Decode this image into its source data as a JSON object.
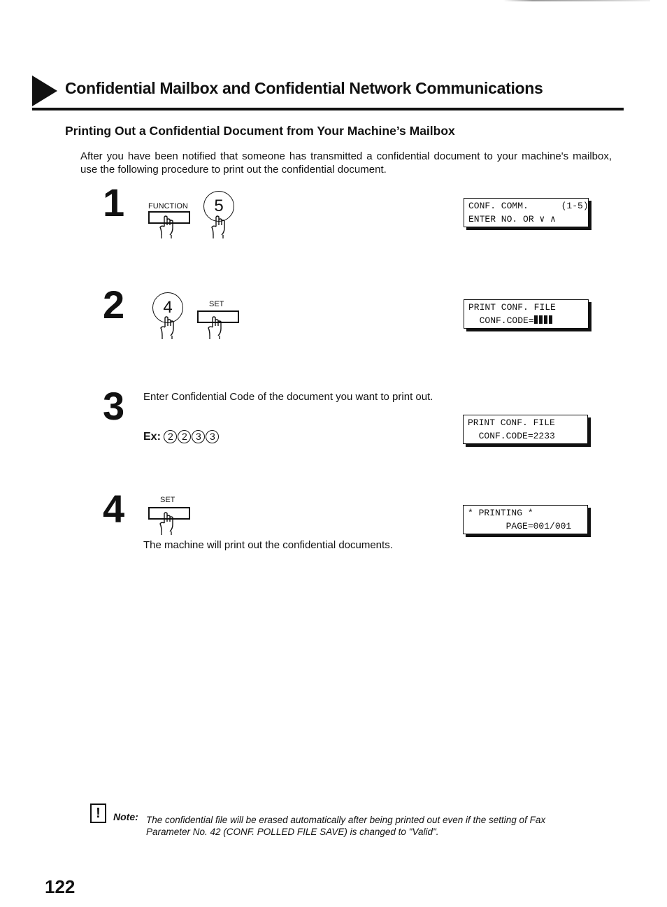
{
  "header": {
    "title": "Confidential Mailbox and Confidential Network Communications"
  },
  "section": {
    "title": "Printing Out a Confidential Document from Your Machine’s Mailbox",
    "intro": "After you have been notified that someone has transmitted a confidential document to your machine's mailbox, use the following procedure to print out the confidential document."
  },
  "steps": [
    {
      "number": "1",
      "keys": [
        {
          "type": "rect",
          "label": "FUNCTION"
        },
        {
          "type": "circle",
          "label": "5"
        }
      ],
      "lcd": [
        "CONF. COMM.      (1-5)",
        "ENTER NO. OR ∨ ∧"
      ]
    },
    {
      "number": "2",
      "keys": [
        {
          "type": "circle",
          "label": "4"
        },
        {
          "type": "rect",
          "label": "SET"
        }
      ],
      "lcd": [
        "PRINT CONF. FILE",
        "  CONF.CODE="
      ],
      "lcd_mask_count": 4
    },
    {
      "number": "3",
      "text": "Enter Confidential Code of the document you want to print out.",
      "example_label": "Ex:",
      "example_digits": [
        "2",
        "2",
        "3",
        "3"
      ],
      "lcd": [
        "PRINT CONF. FILE",
        "  CONF.CODE=2233"
      ]
    },
    {
      "number": "4",
      "keys": [
        {
          "type": "rect",
          "label": "SET"
        }
      ],
      "text": "The machine will print out the confidential documents.",
      "lcd": [
        "* PRINTING *",
        "       PAGE=001/001"
      ]
    }
  ],
  "note": {
    "icon": "exclamation-box-icon",
    "label": "Note:",
    "text": "The confidential file will be erased automatically after being printed out even if the setting of Fax Parameter No. 42 (CONF. POLLED FILE SAVE) is changed to \"Valid\"."
  },
  "page_number": "122"
}
